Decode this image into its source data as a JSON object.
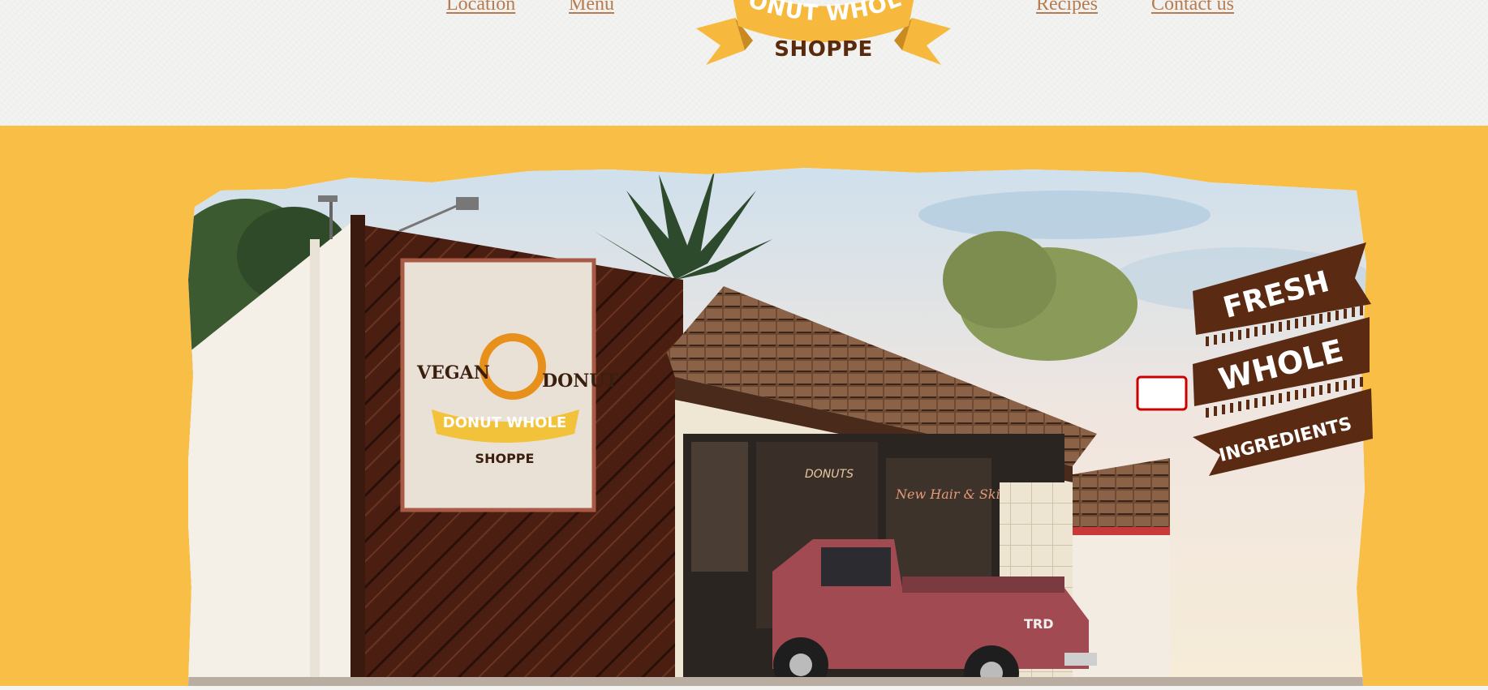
{
  "nav": {
    "links": [
      "Location",
      "Menu",
      "Recipes",
      "Contact us"
    ]
  },
  "logo": {
    "banner_text": "DONUT WHOLE",
    "sub_text": "SHOPPE"
  },
  "hero": {
    "badge": {
      "lines": [
        "FRESH",
        "WHOLE",
        "INGREDIENTS"
      ]
    },
    "photo_signs": {
      "sign_left": "VEGAN",
      "sign_right": "DONUT",
      "sign_banner": "DONUT WHOLE",
      "sign_sub": "SHOPPE",
      "window_text": "DONUTS",
      "window_text_2": "New Hair & Skin",
      "truck_text": "TRD"
    }
  },
  "colors": {
    "accent_yellow": "#f8be46",
    "brown": "#5a2a0c",
    "link_brown": "#b87a4f",
    "header_bg": "#f3f3f1"
  }
}
